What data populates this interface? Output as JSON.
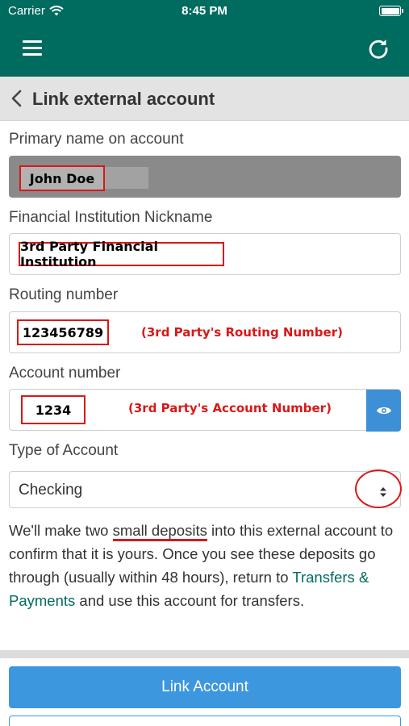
{
  "status_bar": {
    "carrier": "Carrier",
    "time": "8:45 PM",
    "battery_level": 1.0
  },
  "app_bar": {
    "menu_icon": "hamburger-menu-icon",
    "refresh_icon": "refresh-icon",
    "color": "#006b5f"
  },
  "title_bar": {
    "back_icon": "chevron-left-icon",
    "title": "Link external account"
  },
  "form": {
    "primary_name": {
      "label": "Primary name on account",
      "value": "John Doe"
    },
    "nickname": {
      "label": "Financial Institution Nickname",
      "value": "3rd Party Financial Institution"
    },
    "routing": {
      "label": "Routing number",
      "value": "123456789",
      "note": "(3rd Party's Routing Number)"
    },
    "account": {
      "label": "Account number",
      "value": "1234",
      "note": "(3rd Party's Account Number)",
      "reveal_icon": "eye-icon"
    },
    "account_type": {
      "label": "Type of Account",
      "value": "Checking",
      "select_icon": "select-arrows-icon"
    }
  },
  "info": {
    "part1": "We'll make two ",
    "highlight": "small deposits",
    "part2": " into this external account to confirm that it is yours. Once you see these deposits go through (usually within 48 hours), return to ",
    "link": "Transfers & Payments",
    "part3": " and use this account for transfers."
  },
  "actions": {
    "link_account": "Link Account"
  },
  "colors": {
    "brand": "#006b5f",
    "primary_button": "#3d97df",
    "annotation": "#d81818"
  }
}
